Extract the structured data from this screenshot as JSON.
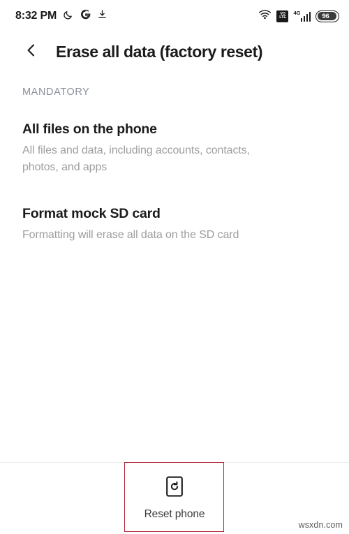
{
  "status_bar": {
    "time": "8:32 PM",
    "left_icons": [
      "moon-icon",
      "google-icon",
      "download-icon"
    ],
    "volte": {
      "line1": "VO",
      "line2": "LTE"
    },
    "network_type": "4G",
    "signal_bars": 4,
    "battery_level": "96"
  },
  "app_bar": {
    "back_icon": "back-chevron-icon",
    "title": "Erase all data (factory reset)"
  },
  "content": {
    "section_header": "MANDATORY",
    "items": [
      {
        "title": "All files on the phone",
        "summary": "All files and data, including accounts, contacts, photos, and apps"
      },
      {
        "title": "Format mock SD card",
        "summary": "Formatting will erase all data on the SD card"
      }
    ]
  },
  "bottom_bar": {
    "reset_icon": "phone-reset-icon",
    "reset_label": "Reset phone"
  },
  "annotation": {
    "color": "#b32b3c"
  },
  "watermark": "wsxdn.com"
}
